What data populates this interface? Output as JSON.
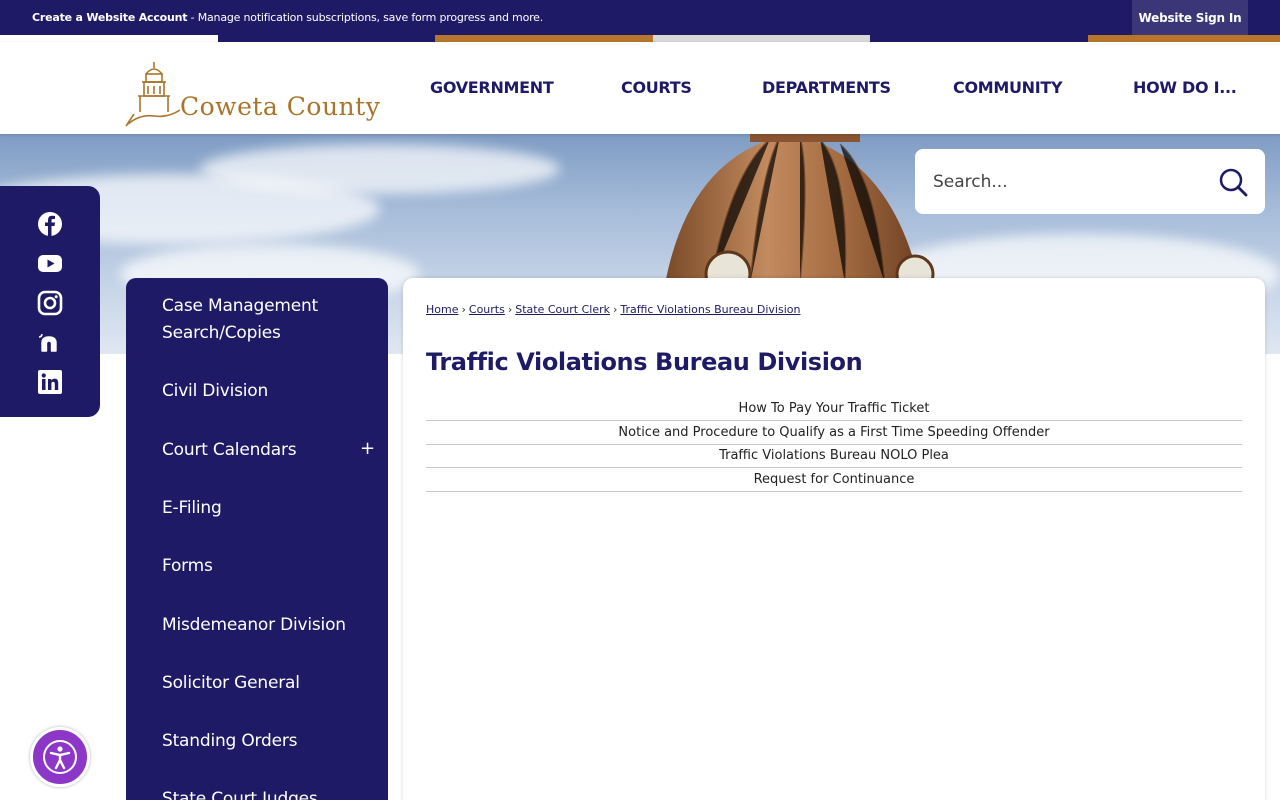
{
  "topbar": {
    "create_account": "Create a Website Account",
    "message": " - Manage notification subscriptions, save form progress and more.",
    "sign_in": "Website Sign In"
  },
  "colors": {
    "primary": "#1f1a66",
    "accent_gold": "#b8752c",
    "accessibility": "#8c37c8"
  },
  "logo": {
    "text_main": "Coweta County",
    "icon": "courthouse-logo-icon"
  },
  "nav": {
    "government": "GOVERNMENT",
    "courts": "COURTS",
    "departments": "DEPARTMENTS",
    "community": "COMMUNITY",
    "how_do_i": "HOW DO I..."
  },
  "search": {
    "placeholder": "Search..."
  },
  "social": [
    "facebook-icon",
    "youtube-icon",
    "instagram-icon",
    "nextdoor-icon",
    "linkedin-icon"
  ],
  "sidebar": {
    "items": [
      {
        "label": "Case Management Search/Copies"
      },
      {
        "label": "Civil Division"
      },
      {
        "label": "Court Calendars",
        "expand": "+"
      },
      {
        "label": "E-Filing"
      },
      {
        "label": "Forms"
      },
      {
        "label": "Misdemeanor Division"
      },
      {
        "label": "Solicitor General"
      },
      {
        "label": "Standing Orders"
      },
      {
        "label": "State Court Judges"
      }
    ]
  },
  "breadcrumb": {
    "home": "Home",
    "courts": "Courts",
    "clerk": "State Court Clerk",
    "current": "Traffic Violations Bureau Division"
  },
  "main": {
    "title": "Traffic Violations Bureau Division",
    "documents": [
      "How To Pay Your Traffic Ticket",
      "Notice and Procedure to Qualify as a First Time Speeding Offender",
      "Traffic Violations Bureau NOLO Plea",
      "Request for Continuance"
    ]
  }
}
